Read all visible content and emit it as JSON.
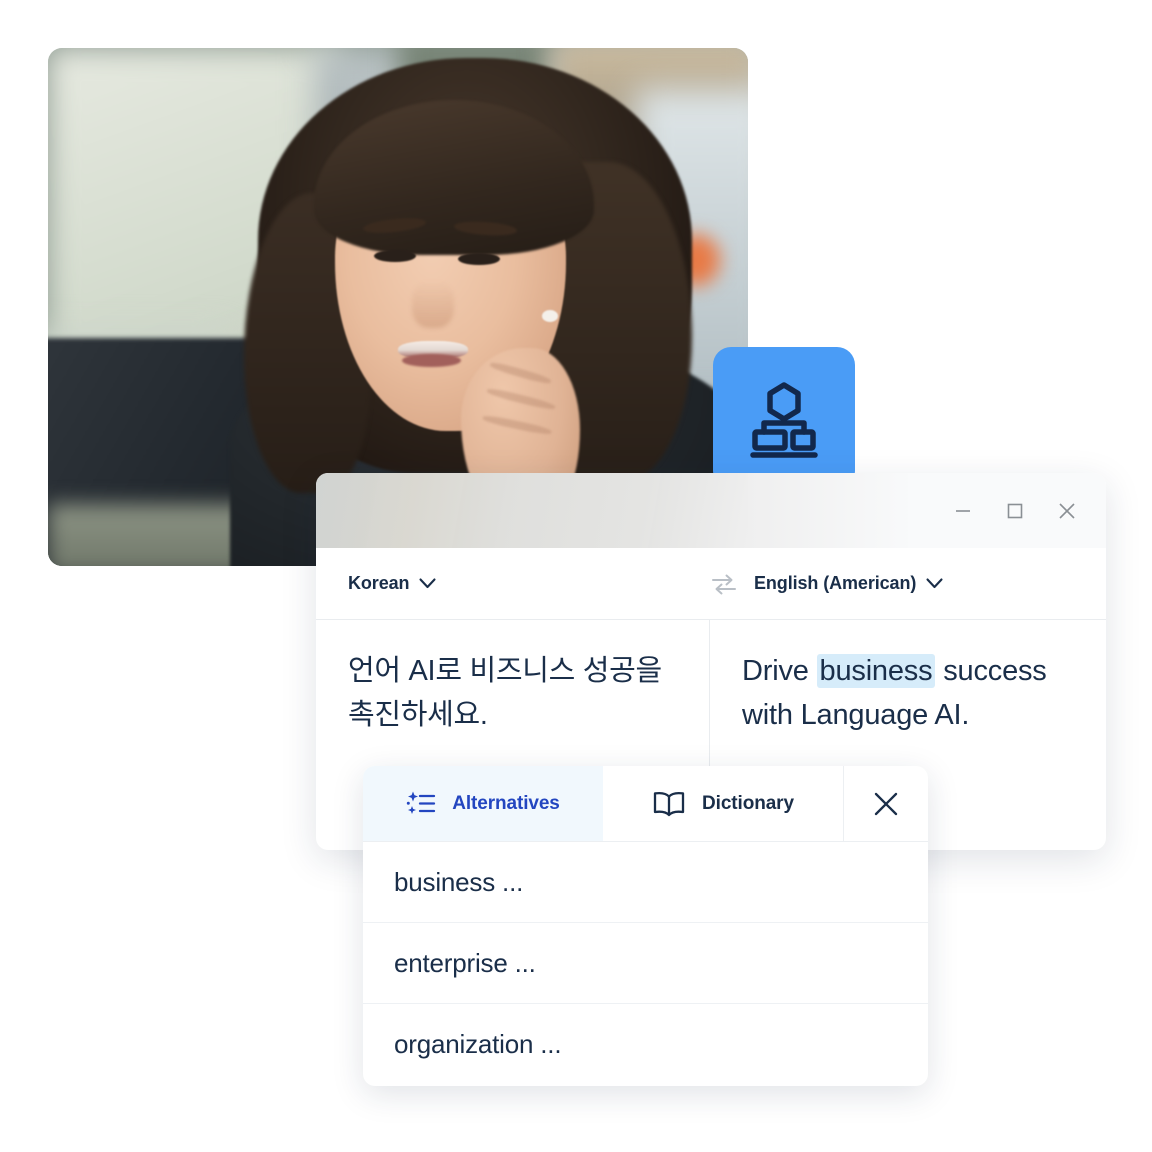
{
  "photo": {
    "alt_description": "Woman smiling at a computer monitor in a bright office",
    "icon_name": "photo-person-at-desk"
  },
  "app_icon": {
    "name": "deepl-app-icon",
    "background_color": "#4a9cf6",
    "glyph_color": "#12284c"
  },
  "window": {
    "titlebar": {
      "minimize_label": "—",
      "maximize_label": "□",
      "close_label": "✕"
    },
    "language_bar": {
      "source_language": "Korean",
      "target_language": "English (American)",
      "swap_icon": "swap-languages-icon",
      "chevron_icon": "chevron-down-icon"
    },
    "source_text": "언어 AI로 비즈니스 성공을 촉진하세요.",
    "target_text_before": "Drive ",
    "target_text_highlight": "business",
    "target_text_after": " success with Language AI.",
    "highlight_color": "#d6ecfa"
  },
  "alternatives_popup": {
    "tabs": [
      {
        "label": "Alternatives",
        "icon": "sparkle-list-icon",
        "active": true
      },
      {
        "label": "Dictionary",
        "icon": "open-book-icon",
        "active": false
      }
    ],
    "close_icon": "close-icon",
    "items": [
      "business ...",
      "enterprise ...",
      "organization ..."
    ],
    "active_tab_color": "#2346c0",
    "active_tab_background": "#f1f8fd"
  }
}
